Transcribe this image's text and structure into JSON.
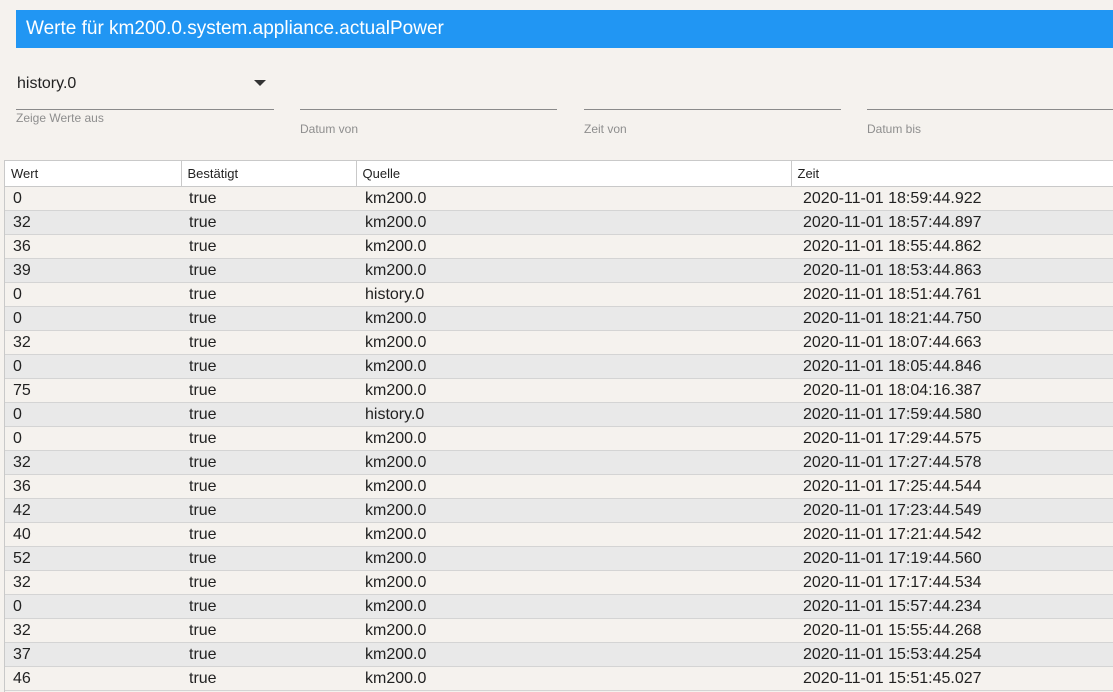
{
  "dialog": {
    "title": "Werte für km200.0.system.appliance.actualPower"
  },
  "filters": {
    "instance_value": "history.0",
    "instance_label": "Zeige Werte aus",
    "date_from_label": "Datum von",
    "time_from_label": "Zeit von",
    "date_to_label": "Datum bis"
  },
  "table": {
    "headers": [
      "Wert",
      "Bestätigt",
      "Quelle",
      "Zeit"
    ],
    "rows": [
      {
        "wert": "0",
        "bestaetigt": "true",
        "quelle": "km200.0",
        "zeit": "2020-11-01 18:59:44.922"
      },
      {
        "wert": "32",
        "bestaetigt": "true",
        "quelle": "km200.0",
        "zeit": "2020-11-01 18:57:44.897"
      },
      {
        "wert": "36",
        "bestaetigt": "true",
        "quelle": "km200.0",
        "zeit": "2020-11-01 18:55:44.862"
      },
      {
        "wert": "39",
        "bestaetigt": "true",
        "quelle": "km200.0",
        "zeit": "2020-11-01 18:53:44.863"
      },
      {
        "wert": "0",
        "bestaetigt": "true",
        "quelle": "history.0",
        "zeit": "2020-11-01 18:51:44.761"
      },
      {
        "wert": "0",
        "bestaetigt": "true",
        "quelle": "km200.0",
        "zeit": "2020-11-01 18:21:44.750"
      },
      {
        "wert": "32",
        "bestaetigt": "true",
        "quelle": "km200.0",
        "zeit": "2020-11-01 18:07:44.663"
      },
      {
        "wert": "0",
        "bestaetigt": "true",
        "quelle": "km200.0",
        "zeit": "2020-11-01 18:05:44.846"
      },
      {
        "wert": "75",
        "bestaetigt": "true",
        "quelle": "km200.0",
        "zeit": "2020-11-01 18:04:16.387"
      },
      {
        "wert": "0",
        "bestaetigt": "true",
        "quelle": "history.0",
        "zeit": "2020-11-01 17:59:44.580"
      },
      {
        "wert": "0",
        "bestaetigt": "true",
        "quelle": "km200.0",
        "zeit": "2020-11-01 17:29:44.575"
      },
      {
        "wert": "32",
        "bestaetigt": "true",
        "quelle": "km200.0",
        "zeit": "2020-11-01 17:27:44.578"
      },
      {
        "wert": "36",
        "bestaetigt": "true",
        "quelle": "km200.0",
        "zeit": "2020-11-01 17:25:44.544"
      },
      {
        "wert": "42",
        "bestaetigt": "true",
        "quelle": "km200.0",
        "zeit": "2020-11-01 17:23:44.549"
      },
      {
        "wert": "40",
        "bestaetigt": "true",
        "quelle": "km200.0",
        "zeit": "2020-11-01 17:21:44.542"
      },
      {
        "wert": "52",
        "bestaetigt": "true",
        "quelle": "km200.0",
        "zeit": "2020-11-01 17:19:44.560"
      },
      {
        "wert": "32",
        "bestaetigt": "true",
        "quelle": "km200.0",
        "zeit": "2020-11-01 17:17:44.534"
      },
      {
        "wert": "0",
        "bestaetigt": "true",
        "quelle": "km200.0",
        "zeit": "2020-11-01 15:57:44.234"
      },
      {
        "wert": "32",
        "bestaetigt": "true",
        "quelle": "km200.0",
        "zeit": "2020-11-01 15:55:44.268"
      },
      {
        "wert": "37",
        "bestaetigt": "true",
        "quelle": "km200.0",
        "zeit": "2020-11-01 15:53:44.254"
      },
      {
        "wert": "46",
        "bestaetigt": "true",
        "quelle": "km200.0",
        "zeit": "2020-11-01 15:51:45.027"
      }
    ]
  }
}
